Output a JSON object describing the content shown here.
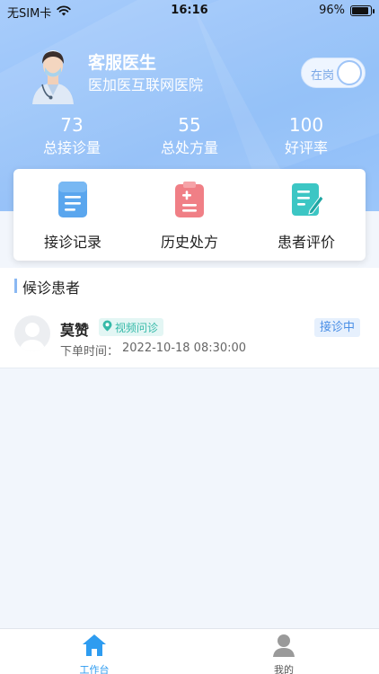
{
  "status_bar": {
    "carrier": "无SIM卡",
    "time": "16:16",
    "battery": "96%",
    "battery_level": 0.96
  },
  "profile": {
    "name": "客服医生",
    "hospital": "医加医互联网医院",
    "avatar_icon": "doctor-avatar-icon",
    "duty_toggle_label": "在岗",
    "duty_on": true
  },
  "stats": [
    {
      "value": "73",
      "label": "总接诊量"
    },
    {
      "value": "55",
      "label": "总处方量"
    },
    {
      "value": "100",
      "label": "好评率"
    }
  ],
  "actions": [
    {
      "label": "接诊记录",
      "icon": "consultation-record-icon",
      "color": "#5aa6ee"
    },
    {
      "label": "历史处方",
      "icon": "prescription-history-icon",
      "color": "#f07f86"
    },
    {
      "label": "患者评价",
      "icon": "patient-review-icon",
      "color": "#3cc6c4"
    }
  ],
  "waiting": {
    "title": "候诊患者",
    "patients": [
      {
        "name": "莫赞",
        "tag": "视频问诊",
        "time_label": "下单时间：",
        "time": "2022-10-18 08:30:00",
        "status": "接诊中"
      }
    ]
  },
  "tabbar": {
    "items": [
      {
        "label": "工作台",
        "icon": "home-icon",
        "active": true
      },
      {
        "label": "我的",
        "icon": "user-icon",
        "active": false
      }
    ]
  },
  "colors": {
    "header": "#8cbcf8",
    "accent": "#4a8fe6",
    "tag": "#35b9a8"
  }
}
